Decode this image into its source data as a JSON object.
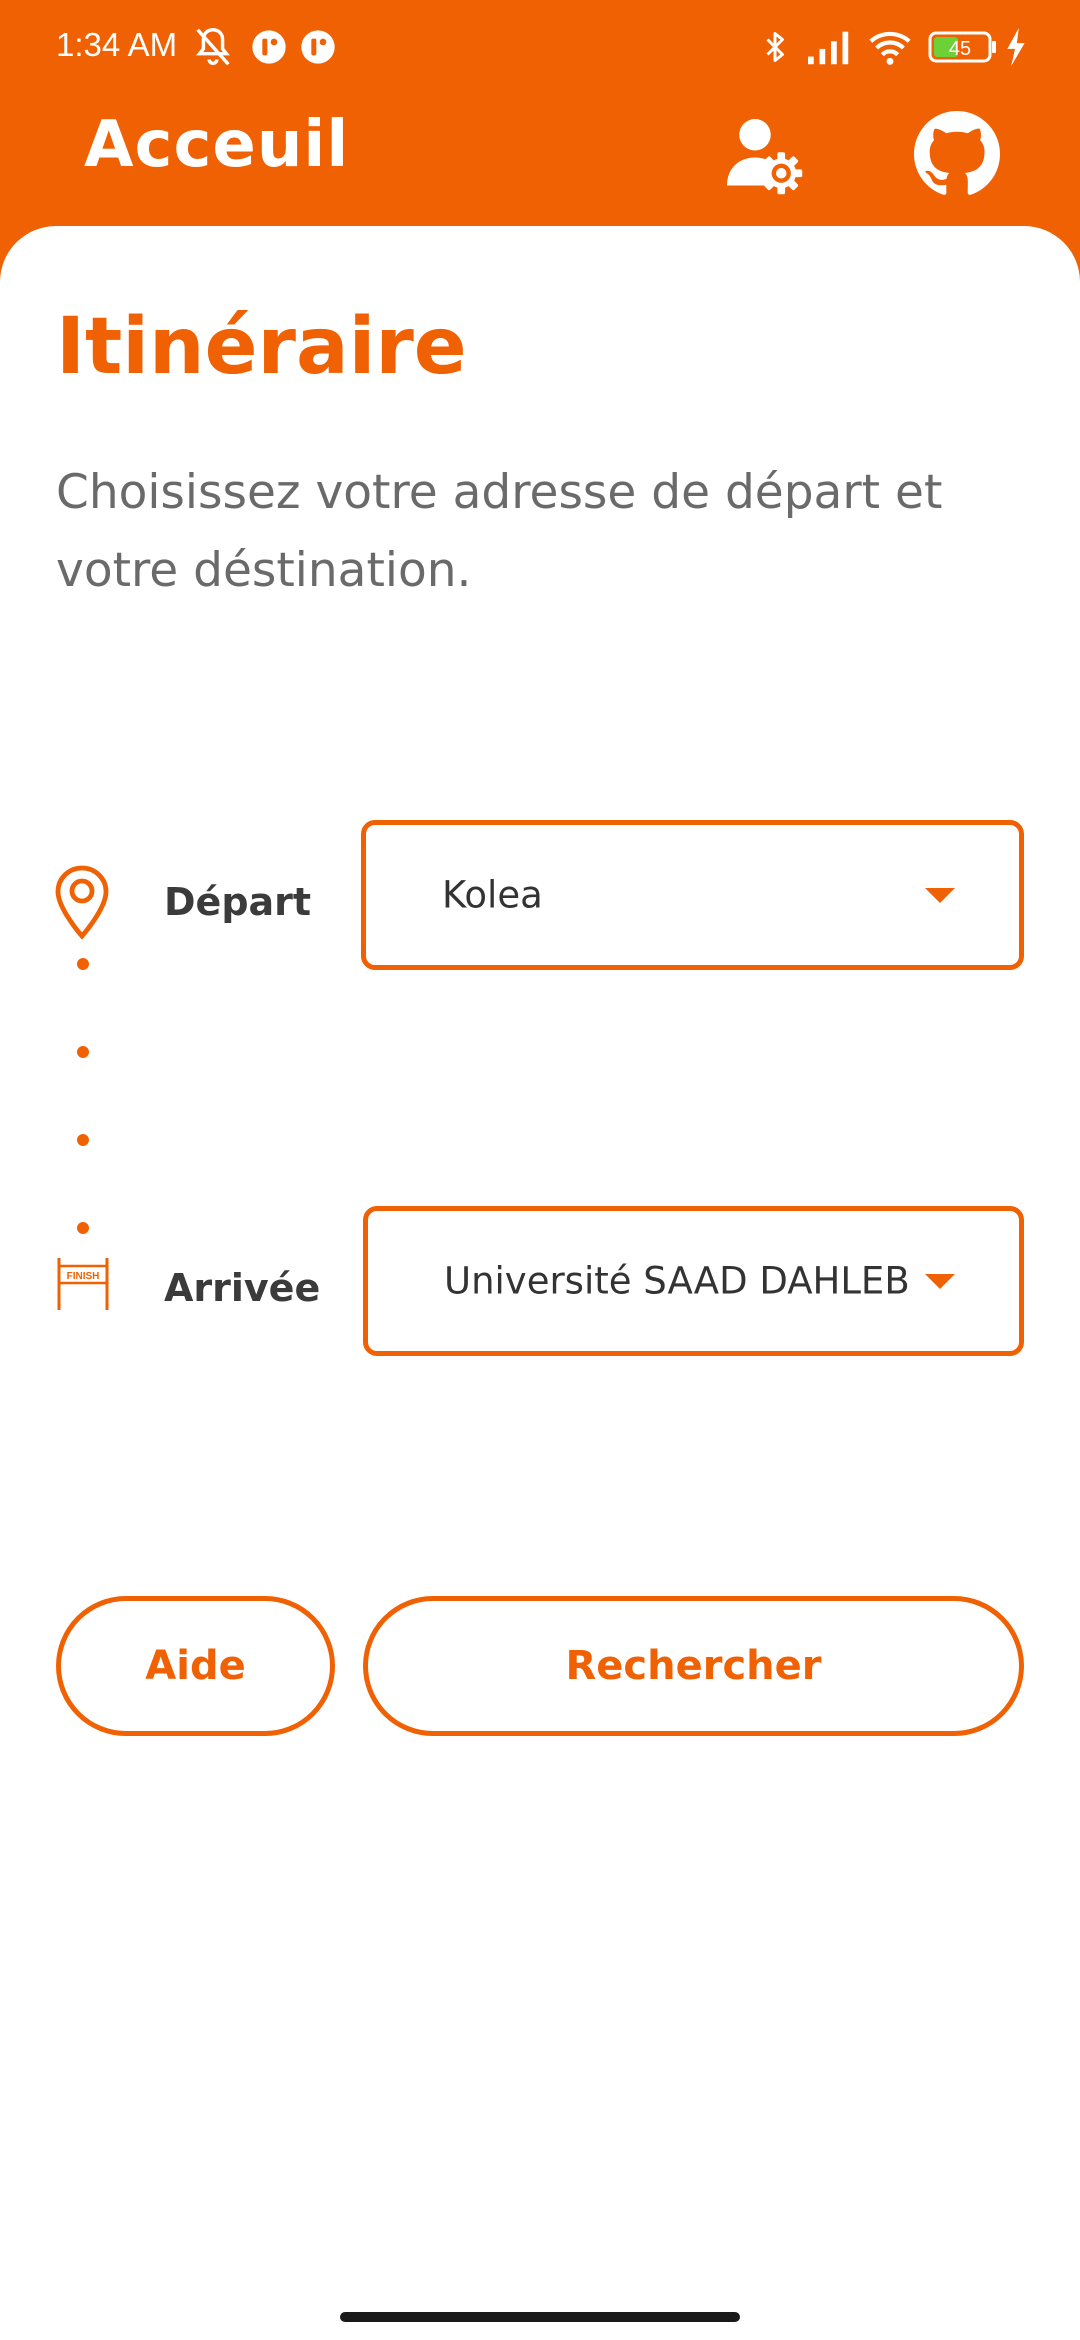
{
  "status_bar": {
    "time": "1:34 AM",
    "battery": "45",
    "icons": [
      "muted-bell-icon",
      "app-notification-icon",
      "app-notification-icon",
      "bluetooth-icon",
      "signal-icon",
      "wifi-icon",
      "battery-icon",
      "charging-icon"
    ]
  },
  "app_bar": {
    "title": "Acceuil",
    "icons": [
      "user-settings-icon",
      "github-icon"
    ]
  },
  "main": {
    "title": "Itinéraire",
    "subtitle": "Choisissez votre adresse de départ et votre déstination."
  },
  "route": {
    "departure": {
      "label": "Départ",
      "value": "Kolea",
      "icon": "location-pin-icon"
    },
    "arrival": {
      "label": "Arrivée",
      "value": "Université SAAD DAHLEB",
      "icon": "finish-line-icon",
      "icon_text": "FINISH"
    }
  },
  "actions": {
    "help_label": "Aide",
    "search_label": "Rechercher"
  },
  "colors": {
    "accent": "#EF6102",
    "background": "#FFFFFF",
    "text_secondary": "#6A6A6A"
  }
}
